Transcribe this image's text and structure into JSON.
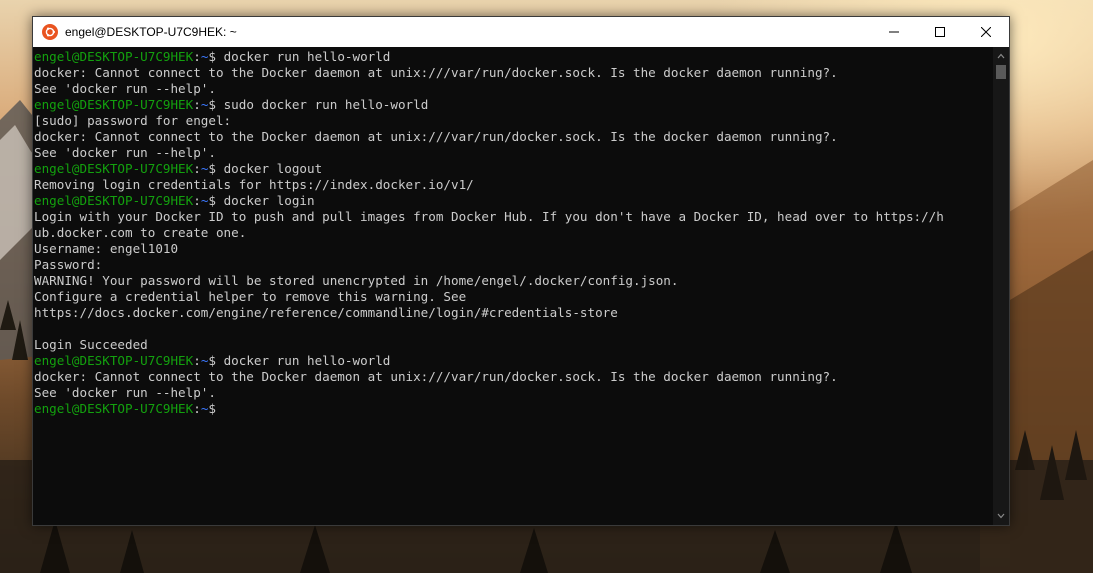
{
  "window": {
    "title": "engel@DESKTOP-U7C9HEK: ~",
    "icon": "ubuntu-icon",
    "controls": [
      "minimize-icon",
      "maximize-icon",
      "close-icon"
    ]
  },
  "terminal": {
    "lines": [
      {
        "type": "prompt",
        "user": "engel@DESKTOP-U7C9HEK",
        "sep": ":",
        "path": "~",
        "cmd": "$ docker run hello-world"
      },
      {
        "type": "text",
        "text": "docker: Cannot connect to the Docker daemon at unix:///var/run/docker.sock. Is the docker daemon running?."
      },
      {
        "type": "text",
        "text": "See 'docker run --help'."
      },
      {
        "type": "prompt",
        "user": "engel@DESKTOP-U7C9HEK",
        "sep": ":",
        "path": "~",
        "cmd": "$ sudo docker run hello-world"
      },
      {
        "type": "text",
        "text": "[sudo] password for engel:"
      },
      {
        "type": "text",
        "text": "docker: Cannot connect to the Docker daemon at unix:///var/run/docker.sock. Is the docker daemon running?."
      },
      {
        "type": "text",
        "text": "See 'docker run --help'."
      },
      {
        "type": "prompt",
        "user": "engel@DESKTOP-U7C9HEK",
        "sep": ":",
        "path": "~",
        "cmd": "$ docker logout"
      },
      {
        "type": "text",
        "text": "Removing login credentials for https://index.docker.io/v1/"
      },
      {
        "type": "prompt",
        "user": "engel@DESKTOP-U7C9HEK",
        "sep": ":",
        "path": "~",
        "cmd": "$ docker login"
      },
      {
        "type": "text",
        "text": "Login with your Docker ID to push and pull images from Docker Hub. If you don't have a Docker ID, head over to https://h"
      },
      {
        "type": "text",
        "text": "ub.docker.com to create one."
      },
      {
        "type": "text",
        "text": "Username: engel1010"
      },
      {
        "type": "text",
        "text": "Password:"
      },
      {
        "type": "text",
        "text": "WARNING! Your password will be stored unencrypted in /home/engel/.docker/config.json."
      },
      {
        "type": "text",
        "text": "Configure a credential helper to remove this warning. See"
      },
      {
        "type": "text",
        "text": "https://docs.docker.com/engine/reference/commandline/login/#credentials-store"
      },
      {
        "type": "text",
        "text": ""
      },
      {
        "type": "text",
        "text": "Login Succeeded"
      },
      {
        "type": "prompt",
        "user": "engel@DESKTOP-U7C9HEK",
        "sep": ":",
        "path": "~",
        "cmd": "$ docker run hello-world"
      },
      {
        "type": "text",
        "text": "docker: Cannot connect to the Docker daemon at unix:///var/run/docker.sock. Is the docker daemon running?."
      },
      {
        "type": "text",
        "text": "See 'docker run --help'."
      },
      {
        "type": "prompt",
        "user": "engel@DESKTOP-U7C9HEK",
        "sep": ":",
        "path": "~",
        "cmd": "$"
      }
    ]
  },
  "colors": {
    "terminal_bg": "#0c0c0c",
    "text": "#cccccc",
    "prompt_user": "#13a10e",
    "prompt_path": "#3b78ff",
    "ubuntu_orange": "#e95420"
  },
  "scrollbar": {
    "icons": [
      "scroll-up-arrow-icon",
      "scroll-down-arrow-icon"
    ]
  }
}
